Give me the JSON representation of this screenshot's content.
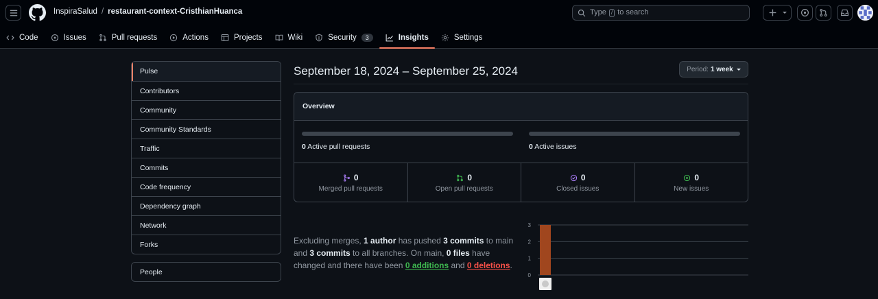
{
  "header": {
    "owner": "InspiraSalud",
    "separator": "/",
    "repo": "restaurant-context-CristhianHuanca",
    "search": {
      "prefix": "Type",
      "key": "/",
      "suffix": "to search"
    }
  },
  "repo_nav": {
    "code": "Code",
    "issues": "Issues",
    "pull_requests": "Pull requests",
    "actions": "Actions",
    "projects": "Projects",
    "wiki": "Wiki",
    "security": "Security",
    "security_count": "3",
    "insights": "Insights",
    "settings": "Settings"
  },
  "sidebar": {
    "items": [
      {
        "label": "Pulse",
        "active": true
      },
      {
        "label": "Contributors"
      },
      {
        "label": "Community"
      },
      {
        "label": "Community Standards"
      },
      {
        "label": "Traffic"
      },
      {
        "label": "Commits"
      },
      {
        "label": "Code frequency"
      },
      {
        "label": "Dependency graph"
      },
      {
        "label": "Network"
      },
      {
        "label": "Forks"
      }
    ],
    "people": "People"
  },
  "main": {
    "date_range": "September 18, 2024 – September 25, 2024",
    "period_label": "Period:",
    "period_value": "1 week",
    "overview": {
      "title": "Overview",
      "active_prs_count": "0",
      "active_prs_label": "Active pull requests",
      "active_issues_count": "0",
      "active_issues_label": "Active issues",
      "stats": [
        {
          "value": "0",
          "label": "Merged pull requests",
          "color": "#ab7df8"
        },
        {
          "value": "0",
          "label": "Open pull requests",
          "color": "#3fb950"
        },
        {
          "value": "0",
          "label": "Closed issues",
          "color": "#ab7df8"
        },
        {
          "value": "0",
          "label": "New issues",
          "color": "#3fb950"
        }
      ]
    },
    "summary": {
      "t1": "Excluding merges, ",
      "authors": "1 author",
      "t2": " has pushed ",
      "commits_main": "3 commits",
      "t3": " to main and ",
      "commits_all": "3 commits",
      "t4": " to all branches. On main, ",
      "files": "0 files",
      "t5": " have changed and there have been ",
      "additions": "0 additions",
      "t6": " and ",
      "deletions": "0 deletions",
      "t7": "."
    }
  },
  "chart_data": {
    "type": "bar",
    "categories": [
      "CristhianHuanca avatar"
    ],
    "values": [
      3
    ],
    "ylim": [
      0,
      3
    ],
    "yticks": [
      "0",
      "1",
      "2",
      "3"
    ],
    "grid": true,
    "bar_color": "#a0461e"
  }
}
